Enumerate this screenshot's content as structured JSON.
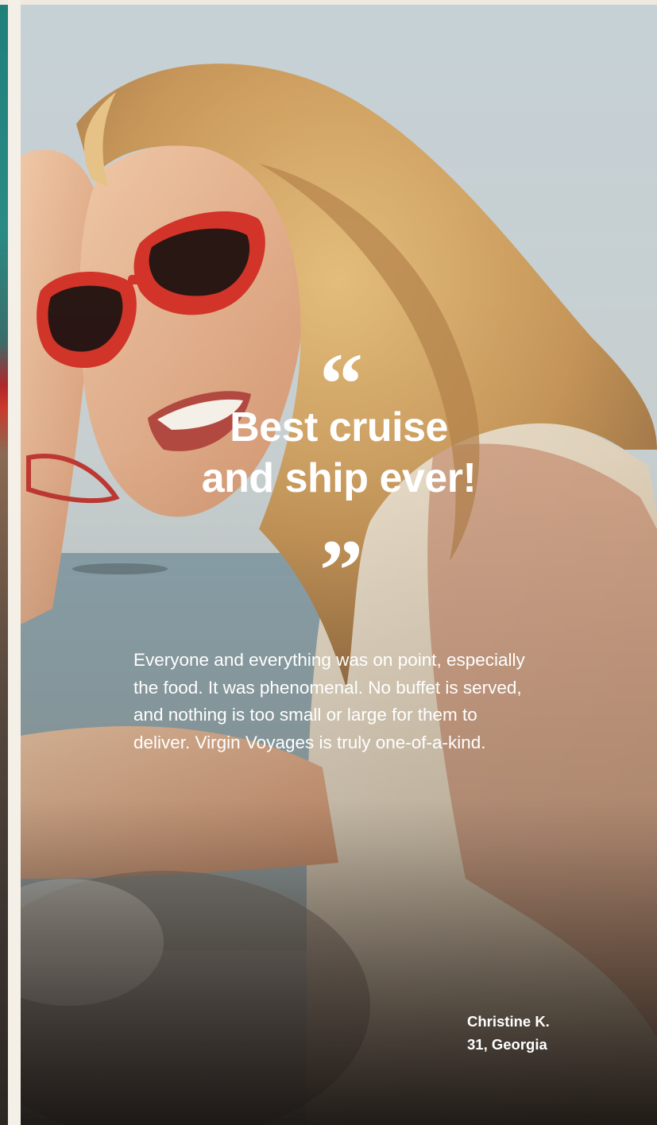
{
  "testimonial": {
    "quote_open_mark": "“",
    "headline_lines": [
      "Best cruise",
      "and ship ever!"
    ],
    "quote_close_mark": "”",
    "body": "Everyone and everything was on point, especially the food. It was phenomenal. No buffet is served, and nothing is too small or large for them to deliver. Virgin Voyages is truly one-of-a-kind.",
    "author": {
      "name": "Christine K.",
      "details": "31, Georgia"
    }
  },
  "colors": {
    "text": "#ffffff",
    "page_background": "#f3eee6",
    "sky": "#c9d3d6",
    "sunglasses": "#d6352a",
    "hair": "#d7a867",
    "dress": "#eadcc6"
  }
}
